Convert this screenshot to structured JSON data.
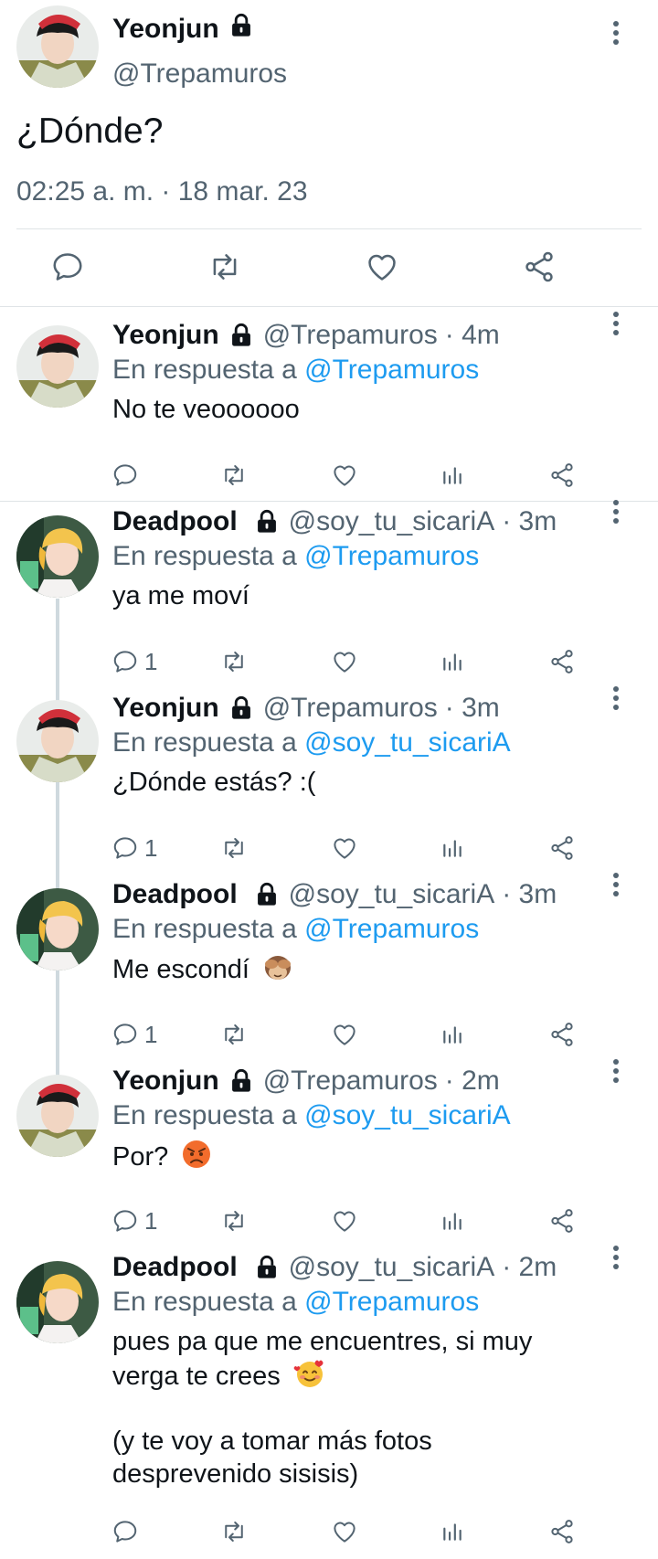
{
  "main_tweet": {
    "author_name": "Yeonjun",
    "author_handle": "@Trepamuros",
    "text": "¿Dónde?",
    "timestamp": "02:25 a. m. · 18 mar. 23",
    "actions": [
      "reply-icon",
      "retweet-icon",
      "like-icon",
      "share-icon"
    ]
  },
  "replying_label": "En respuesta a",
  "replies": [
    {
      "name": "Yeonjun",
      "handle": "@Trepamuros",
      "time": "· 4m",
      "reply_to": "@Trepamuros",
      "text": "No te veoooooo",
      "reply_count": "",
      "avatar": "yeonjun"
    },
    {
      "name": "Deadpool",
      "handle": "@soy_tu_sicariA",
      "time": "· 3m",
      "reply_to": "@Trepamuros",
      "text": "ya me moví",
      "reply_count": "1",
      "avatar": "deadpool"
    },
    {
      "name": "Yeonjun",
      "handle": "@Trepamuros",
      "time": "· 3m",
      "reply_to": "@soy_tu_sicariA",
      "text": "¿Dónde estás? :(",
      "reply_count": "1",
      "avatar": "yeonjun"
    },
    {
      "name": "Deadpool",
      "handle": "@soy_tu_sicariA",
      "time": "· 3m",
      "reply_to": "@Trepamuros",
      "text": "Me escondí",
      "emoji": "see-no-evil-monkey",
      "reply_count": "1",
      "avatar": "deadpool"
    },
    {
      "name": "Yeonjun",
      "handle": "@Trepamuros",
      "time": "· 2m",
      "reply_to": "@soy_tu_sicariA",
      "text": "Por?",
      "emoji": "angry-face",
      "reply_count": "1",
      "avatar": "yeonjun"
    },
    {
      "name": "Deadpool",
      "handle": "@soy_tu_sicariA",
      "time": "· 2m",
      "reply_to": "@Trepamuros",
      "text_lines": [
        "pues pa que me encuentres, si muy",
        "verga te crees",
        "",
        "(y te voy a tomar más fotos",
        "desprevenido sisisis)"
      ],
      "emoji": "smiling-face-with-hearts",
      "reply_count": "",
      "avatar": "deadpool"
    }
  ],
  "colors": {
    "text": "#0f1419",
    "secondary": "#536471",
    "link": "#1d9bf0",
    "divider": "#dfe3e6",
    "thread_line": "#cfd9de"
  }
}
